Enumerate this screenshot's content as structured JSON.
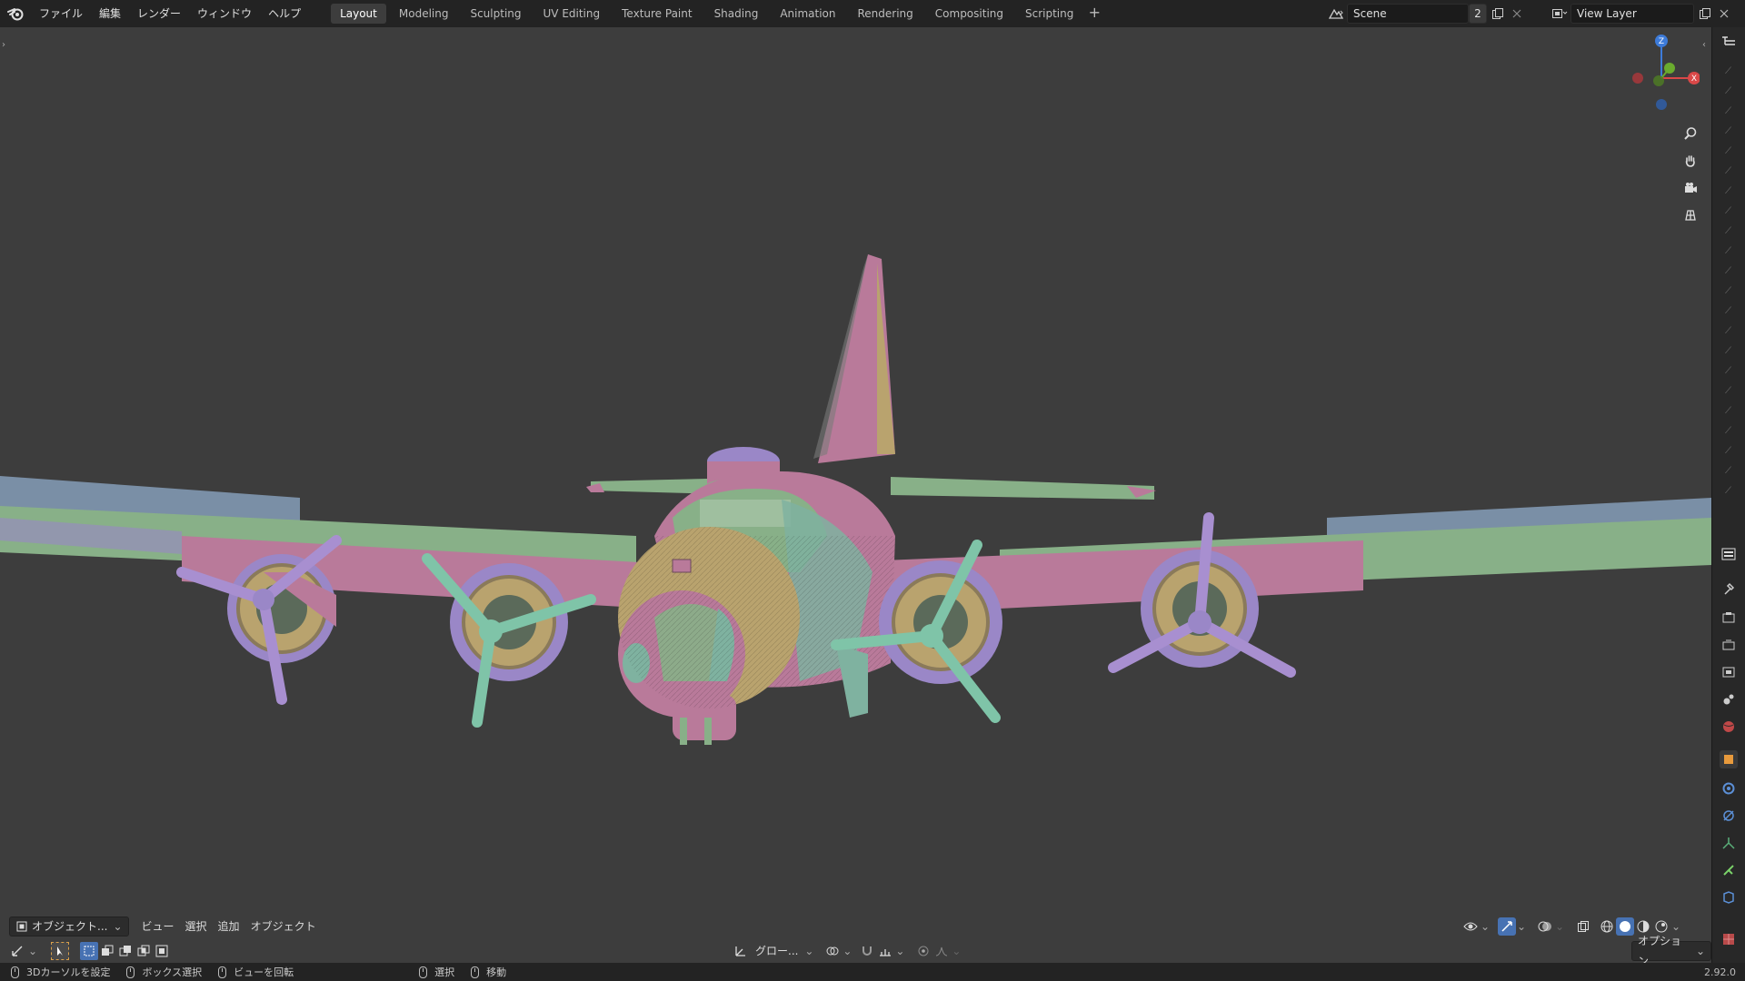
{
  "topbar": {
    "menus": [
      "ファイル",
      "編集",
      "レンダー",
      "ウィンドウ",
      "ヘルプ"
    ],
    "workspaces": [
      "Layout",
      "Modeling",
      "Sculpting",
      "UV Editing",
      "Texture Paint",
      "Shading",
      "Animation",
      "Rendering",
      "Compositing",
      "Scripting"
    ],
    "active_workspace": "Layout",
    "add_label": "+",
    "scene_name": "Scene",
    "scene_users": "2",
    "view_layer": "View Layer"
  },
  "viewport": {
    "gizmo": {
      "z": "Z",
      "x": "X"
    },
    "header": {
      "mode": "オブジェクト...",
      "view": "ビュー",
      "select": "選択",
      "add": "追加",
      "object": "オブジェクト",
      "transform_orientation": "グロー...",
      "options": "オプション"
    }
  },
  "statusbar": {
    "items": [
      "3Dカーソルを設定",
      "ボックス選択",
      "ビューを回転",
      "選択",
      "移動"
    ],
    "version": "2.92.0"
  },
  "colors": {
    "viewport_bg": "#3d3d3d",
    "pink": "#b97a9a",
    "green": "#88b088",
    "purple": "#9a87c7",
    "tan": "#b9a36e",
    "teal": "#7fb2a0"
  }
}
